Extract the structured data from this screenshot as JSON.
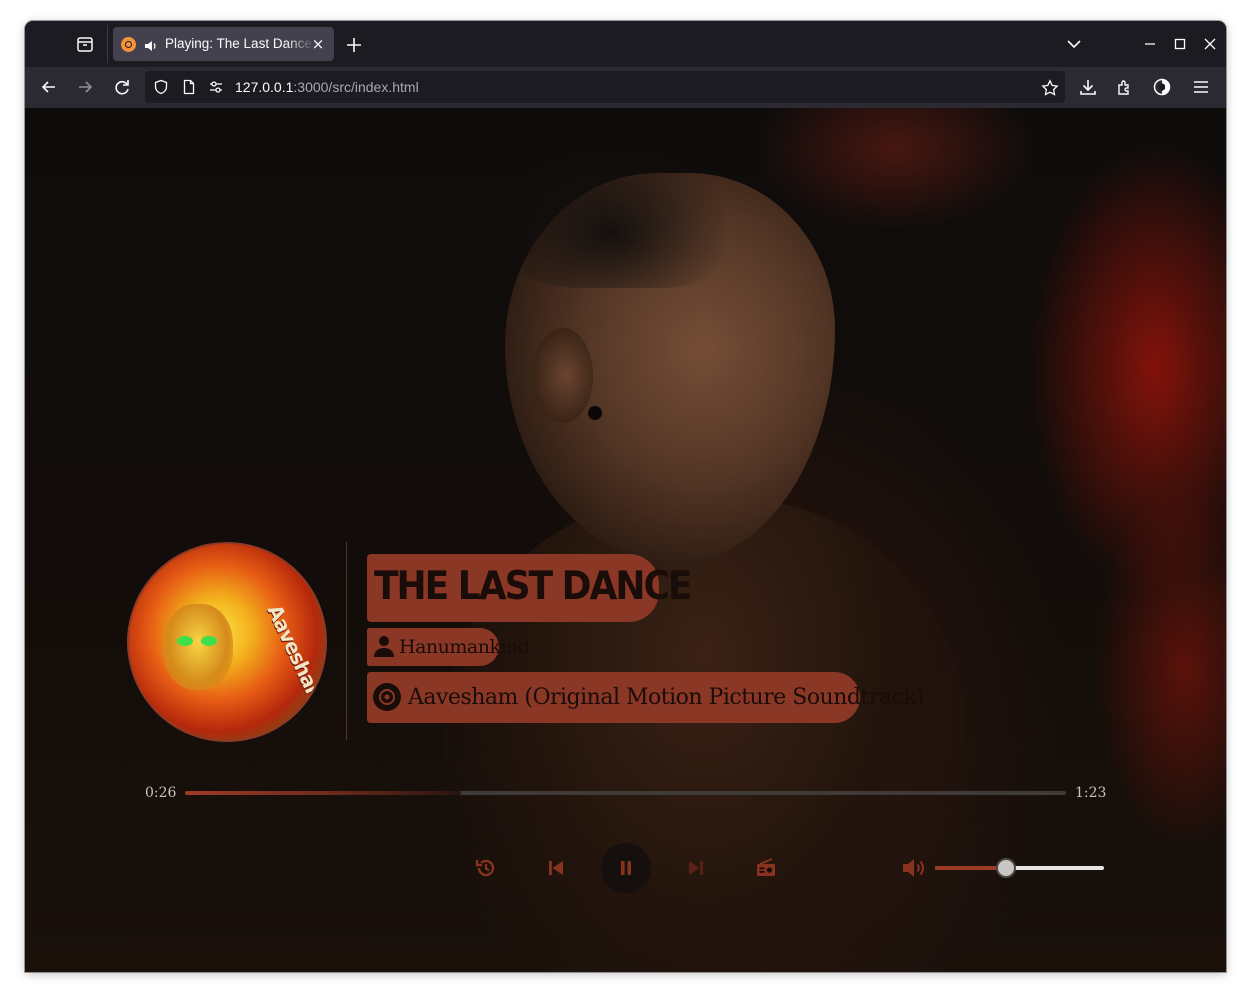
{
  "browser": {
    "tab": {
      "title": "Playing: The Last Dance",
      "close_glyph": "×",
      "favicon": "orange-circle-icon",
      "audio_indicator": "speaker-icon"
    },
    "url": {
      "host": "127.0.0.1",
      "rest": ":3000/src/index.html"
    },
    "icons": {
      "tab_list": "tab-list-icon",
      "new_tab": "plus-icon",
      "all_tabs": "chevron-down-icon",
      "minimize": "minimize-icon",
      "maximize": "maximize-icon",
      "close": "close-icon",
      "back": "back-arrow-icon",
      "forward": "forward-arrow-icon",
      "reload": "reload-icon",
      "tracking": "shield-icon",
      "page": "page-icon",
      "permissions": "permissions-icon",
      "bookmark": "star-icon",
      "downloads": "download-icon",
      "extensions": "puzzle-icon",
      "account": "account-icon",
      "menu": "hamburger-menu-icon"
    }
  },
  "player": {
    "song_title": "THE LAST DANCE",
    "artist": "Hanumankind",
    "album": "Aavesham (Original Motion Picture Soundtrack)",
    "album_art_text": "Aavesham",
    "current_time": "0:26",
    "duration": "1:23",
    "progress_fraction": 0.313,
    "volume_fraction": 0.42,
    "is_playing": true,
    "controls": {
      "replay": "replay-icon",
      "previous": "skip-previous-icon",
      "play_pause": "pause-icon",
      "next": "skip-next-icon",
      "radio": "radio-icon",
      "volume": "volume-high-icon"
    },
    "colors": {
      "accent": "#8a3726",
      "accent_text": "#1a0c08",
      "control_icon": "#8a3220",
      "background": "#130d0a"
    }
  }
}
